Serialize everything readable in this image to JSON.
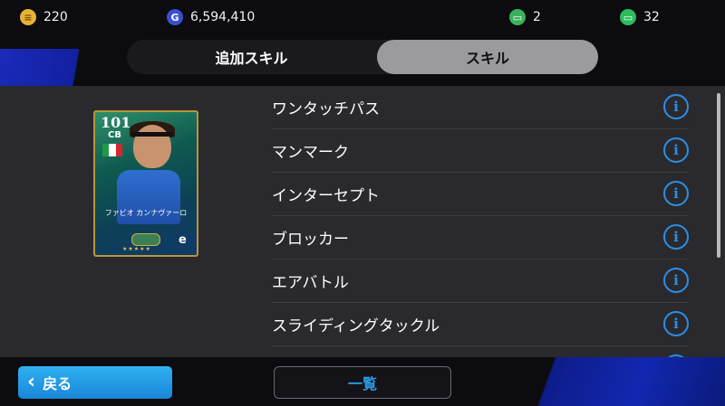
{
  "topbar": {
    "coins": "220",
    "gp": "6,594,410",
    "ticket_a": "2",
    "ticket_b": "32",
    "gp_symbol": "G"
  },
  "tabs": [
    {
      "label": "追加スキル",
      "active": false
    },
    {
      "label": "スキル",
      "active": true
    }
  ],
  "card": {
    "rating": "101",
    "position": "CB",
    "player_name": "ファビオ カンナヴァーロ",
    "stars": "★★★★★",
    "logo": "e"
  },
  "skills": [
    {
      "label": "ワンタッチパス"
    },
    {
      "label": "マンマーク"
    },
    {
      "label": "インターセプト"
    },
    {
      "label": "ブロッカー"
    },
    {
      "label": "エアバトル"
    },
    {
      "label": "スライディングタックル"
    },
    {
      "label": ""
    }
  ],
  "info_symbol": "i",
  "bottom": {
    "back_label": "戻る",
    "list_label": "一覧"
  },
  "colors": {
    "accent_blue": "#2b8fe6",
    "panel_bg": "#2a2a2e",
    "card_border": "#b8953c",
    "active_tab": "#9a9a9f"
  }
}
